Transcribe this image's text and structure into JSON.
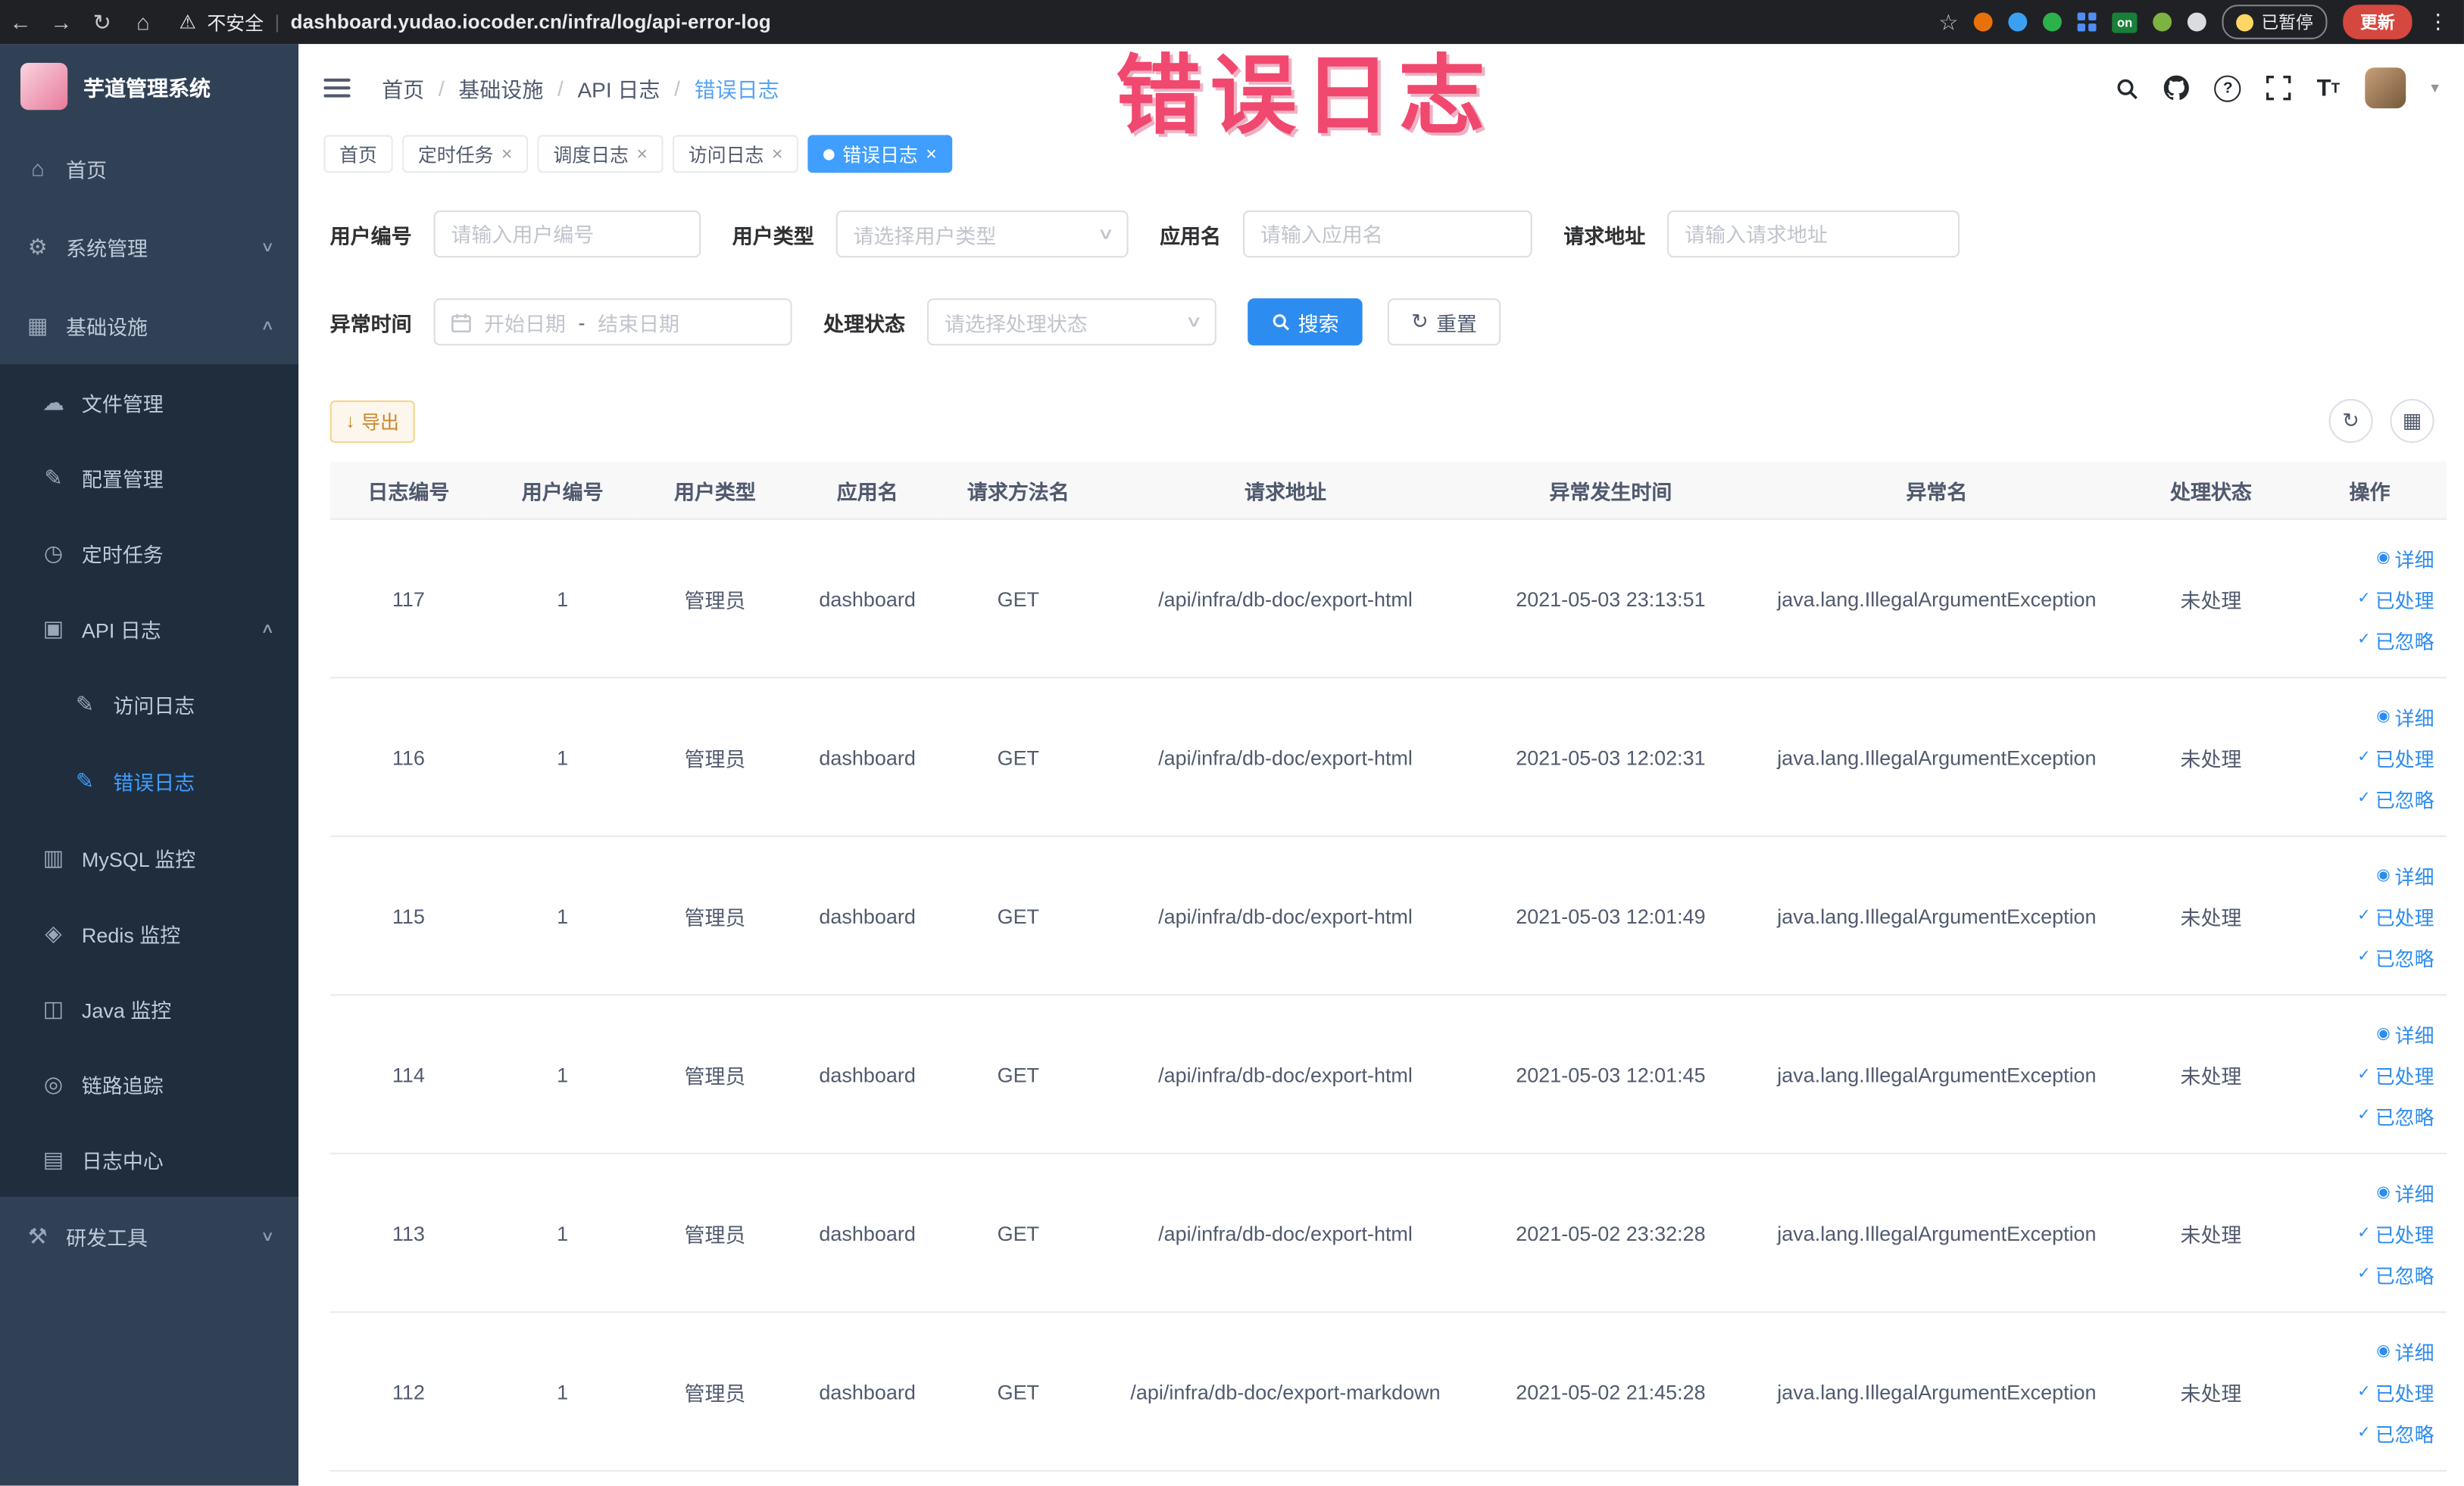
{
  "browser": {
    "security_label": "不安全",
    "url": "dashboard.yudao.iocoder.cn/infra/log/api-error-log",
    "on_badge": "on",
    "paused_badge": "已暂停",
    "update_button": "更新"
  },
  "annotation": {
    "text": "错误日志"
  },
  "sidebar": {
    "logo_title": "芋道管理系统",
    "home": "首页",
    "system": "系统管理",
    "infra": "基础设施",
    "file": "文件管理",
    "config": "配置管理",
    "job": "定时任务",
    "api_log": "API 日志",
    "access_log": "访问日志",
    "error_log": "错误日志",
    "mysql": "MySQL 监控",
    "redis": "Redis 监控",
    "java": "Java 监控",
    "trace": "链路追踪",
    "log_center": "日志中心",
    "dev": "研发工具"
  },
  "breadcrumb": {
    "items": [
      "首页",
      "基础设施",
      "API 日志",
      "错误日志"
    ]
  },
  "tabs": [
    {
      "label": "首页",
      "closable": false,
      "active": false
    },
    {
      "label": "定时任务",
      "closable": true,
      "active": false
    },
    {
      "label": "调度日志",
      "closable": true,
      "active": false
    },
    {
      "label": "访问日志",
      "closable": true,
      "active": false
    },
    {
      "label": "错误日志",
      "closable": true,
      "active": true
    }
  ],
  "filters": {
    "user_id": {
      "label": "用户编号",
      "placeholder": "请输入用户编号"
    },
    "user_type": {
      "label": "用户类型",
      "placeholder": "请选择用户类型"
    },
    "app_name": {
      "label": "应用名",
      "placeholder": "请输入应用名"
    },
    "request_url": {
      "label": "请求地址",
      "placeholder": "请输入请求地址"
    },
    "exception_time": {
      "label": "异常时间",
      "start_placeholder": "开始日期",
      "separator": "-",
      "end_placeholder": "结束日期"
    },
    "process_status": {
      "label": "处理状态",
      "placeholder": "请选择处理状态"
    },
    "search_label": "搜索",
    "reset_label": "重置"
  },
  "toolbar": {
    "export_label": "导出"
  },
  "table": {
    "columns": [
      "日志编号",
      "用户编号",
      "用户类型",
      "应用名",
      "请求方法名",
      "请求地址",
      "异常发生时间",
      "异常名",
      "处理状态",
      "操作"
    ],
    "row_actions": {
      "detail": "详细",
      "processed": "已处理",
      "ignored": "已忽略"
    },
    "rows": [
      {
        "id": "117",
        "user_id": "1",
        "user_type": "管理员",
        "app": "dashboard",
        "method": "GET",
        "url": "/api/infra/db-doc/export-html",
        "time": "2021-05-03 23:13:51",
        "exception": "java.lang.IllegalArgumentException",
        "status": "未处理"
      },
      {
        "id": "116",
        "user_id": "1",
        "user_type": "管理员",
        "app": "dashboard",
        "method": "GET",
        "url": "/api/infra/db-doc/export-html",
        "time": "2021-05-03 12:02:31",
        "exception": "java.lang.IllegalArgumentException",
        "status": "未处理"
      },
      {
        "id": "115",
        "user_id": "1",
        "user_type": "管理员",
        "app": "dashboard",
        "method": "GET",
        "url": "/api/infra/db-doc/export-html",
        "time": "2021-05-03 12:01:49",
        "exception": "java.lang.IllegalArgumentException",
        "status": "未处理"
      },
      {
        "id": "114",
        "user_id": "1",
        "user_type": "管理员",
        "app": "dashboard",
        "method": "GET",
        "url": "/api/infra/db-doc/export-html",
        "time": "2021-05-03 12:01:45",
        "exception": "java.lang.IllegalArgumentException",
        "status": "未处理"
      },
      {
        "id": "113",
        "user_id": "1",
        "user_type": "管理员",
        "app": "dashboard",
        "method": "GET",
        "url": "/api/infra/db-doc/export-html",
        "time": "2021-05-02 23:32:28",
        "exception": "java.lang.IllegalArgumentException",
        "status": "未处理"
      },
      {
        "id": "112",
        "user_id": "1",
        "user_type": "管理员",
        "app": "dashboard",
        "method": "GET",
        "url": "/api/infra/db-doc/export-markdown",
        "time": "2021-05-02 21:45:28",
        "exception": "java.lang.IllegalArgumentException",
        "status": "未处理"
      }
    ]
  },
  "colors": {
    "primary": "#2d8cf0",
    "menu_active": "#409eff",
    "annotation": "#f0486f"
  }
}
